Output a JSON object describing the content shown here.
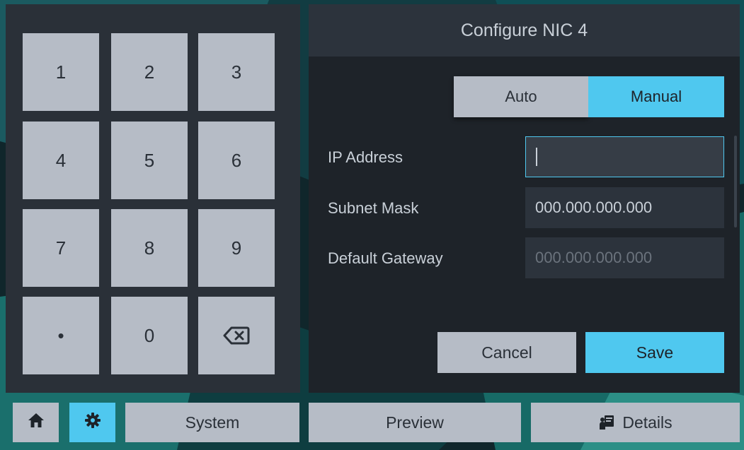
{
  "keypad": {
    "keys": [
      {
        "label": "1"
      },
      {
        "label": "2"
      },
      {
        "label": "3"
      },
      {
        "label": "4"
      },
      {
        "label": "5"
      },
      {
        "label": "6"
      },
      {
        "label": "7"
      },
      {
        "label": "8"
      },
      {
        "label": "9"
      },
      {
        "label": "•"
      },
      {
        "label": "0"
      },
      {
        "icon": "backspace-icon"
      }
    ]
  },
  "config": {
    "title": "Configure NIC 4",
    "mode": {
      "auto_label": "Auto",
      "manual_label": "Manual",
      "selected": "Manual"
    },
    "fields": {
      "ip_label": "IP Address",
      "ip_value": "",
      "subnet_label": "Subnet Mask",
      "subnet_value": "000.000.000.000",
      "gateway_label": "Default Gateway",
      "gateway_placeholder": "000.000.000.000"
    },
    "cancel_label": "Cancel",
    "save_label": "Save"
  },
  "bottom_bar": {
    "home_icon": "home-icon",
    "settings_icon": "gear-icon",
    "system_label": "System",
    "preview_label": "Preview",
    "details_label": "Details",
    "details_icon": "presenter-icon"
  },
  "colors": {
    "accent": "#4fc8ef",
    "key_bg": "#b6bcc6",
    "panel_bg": "#2a3038",
    "config_bg": "#1e2329"
  }
}
